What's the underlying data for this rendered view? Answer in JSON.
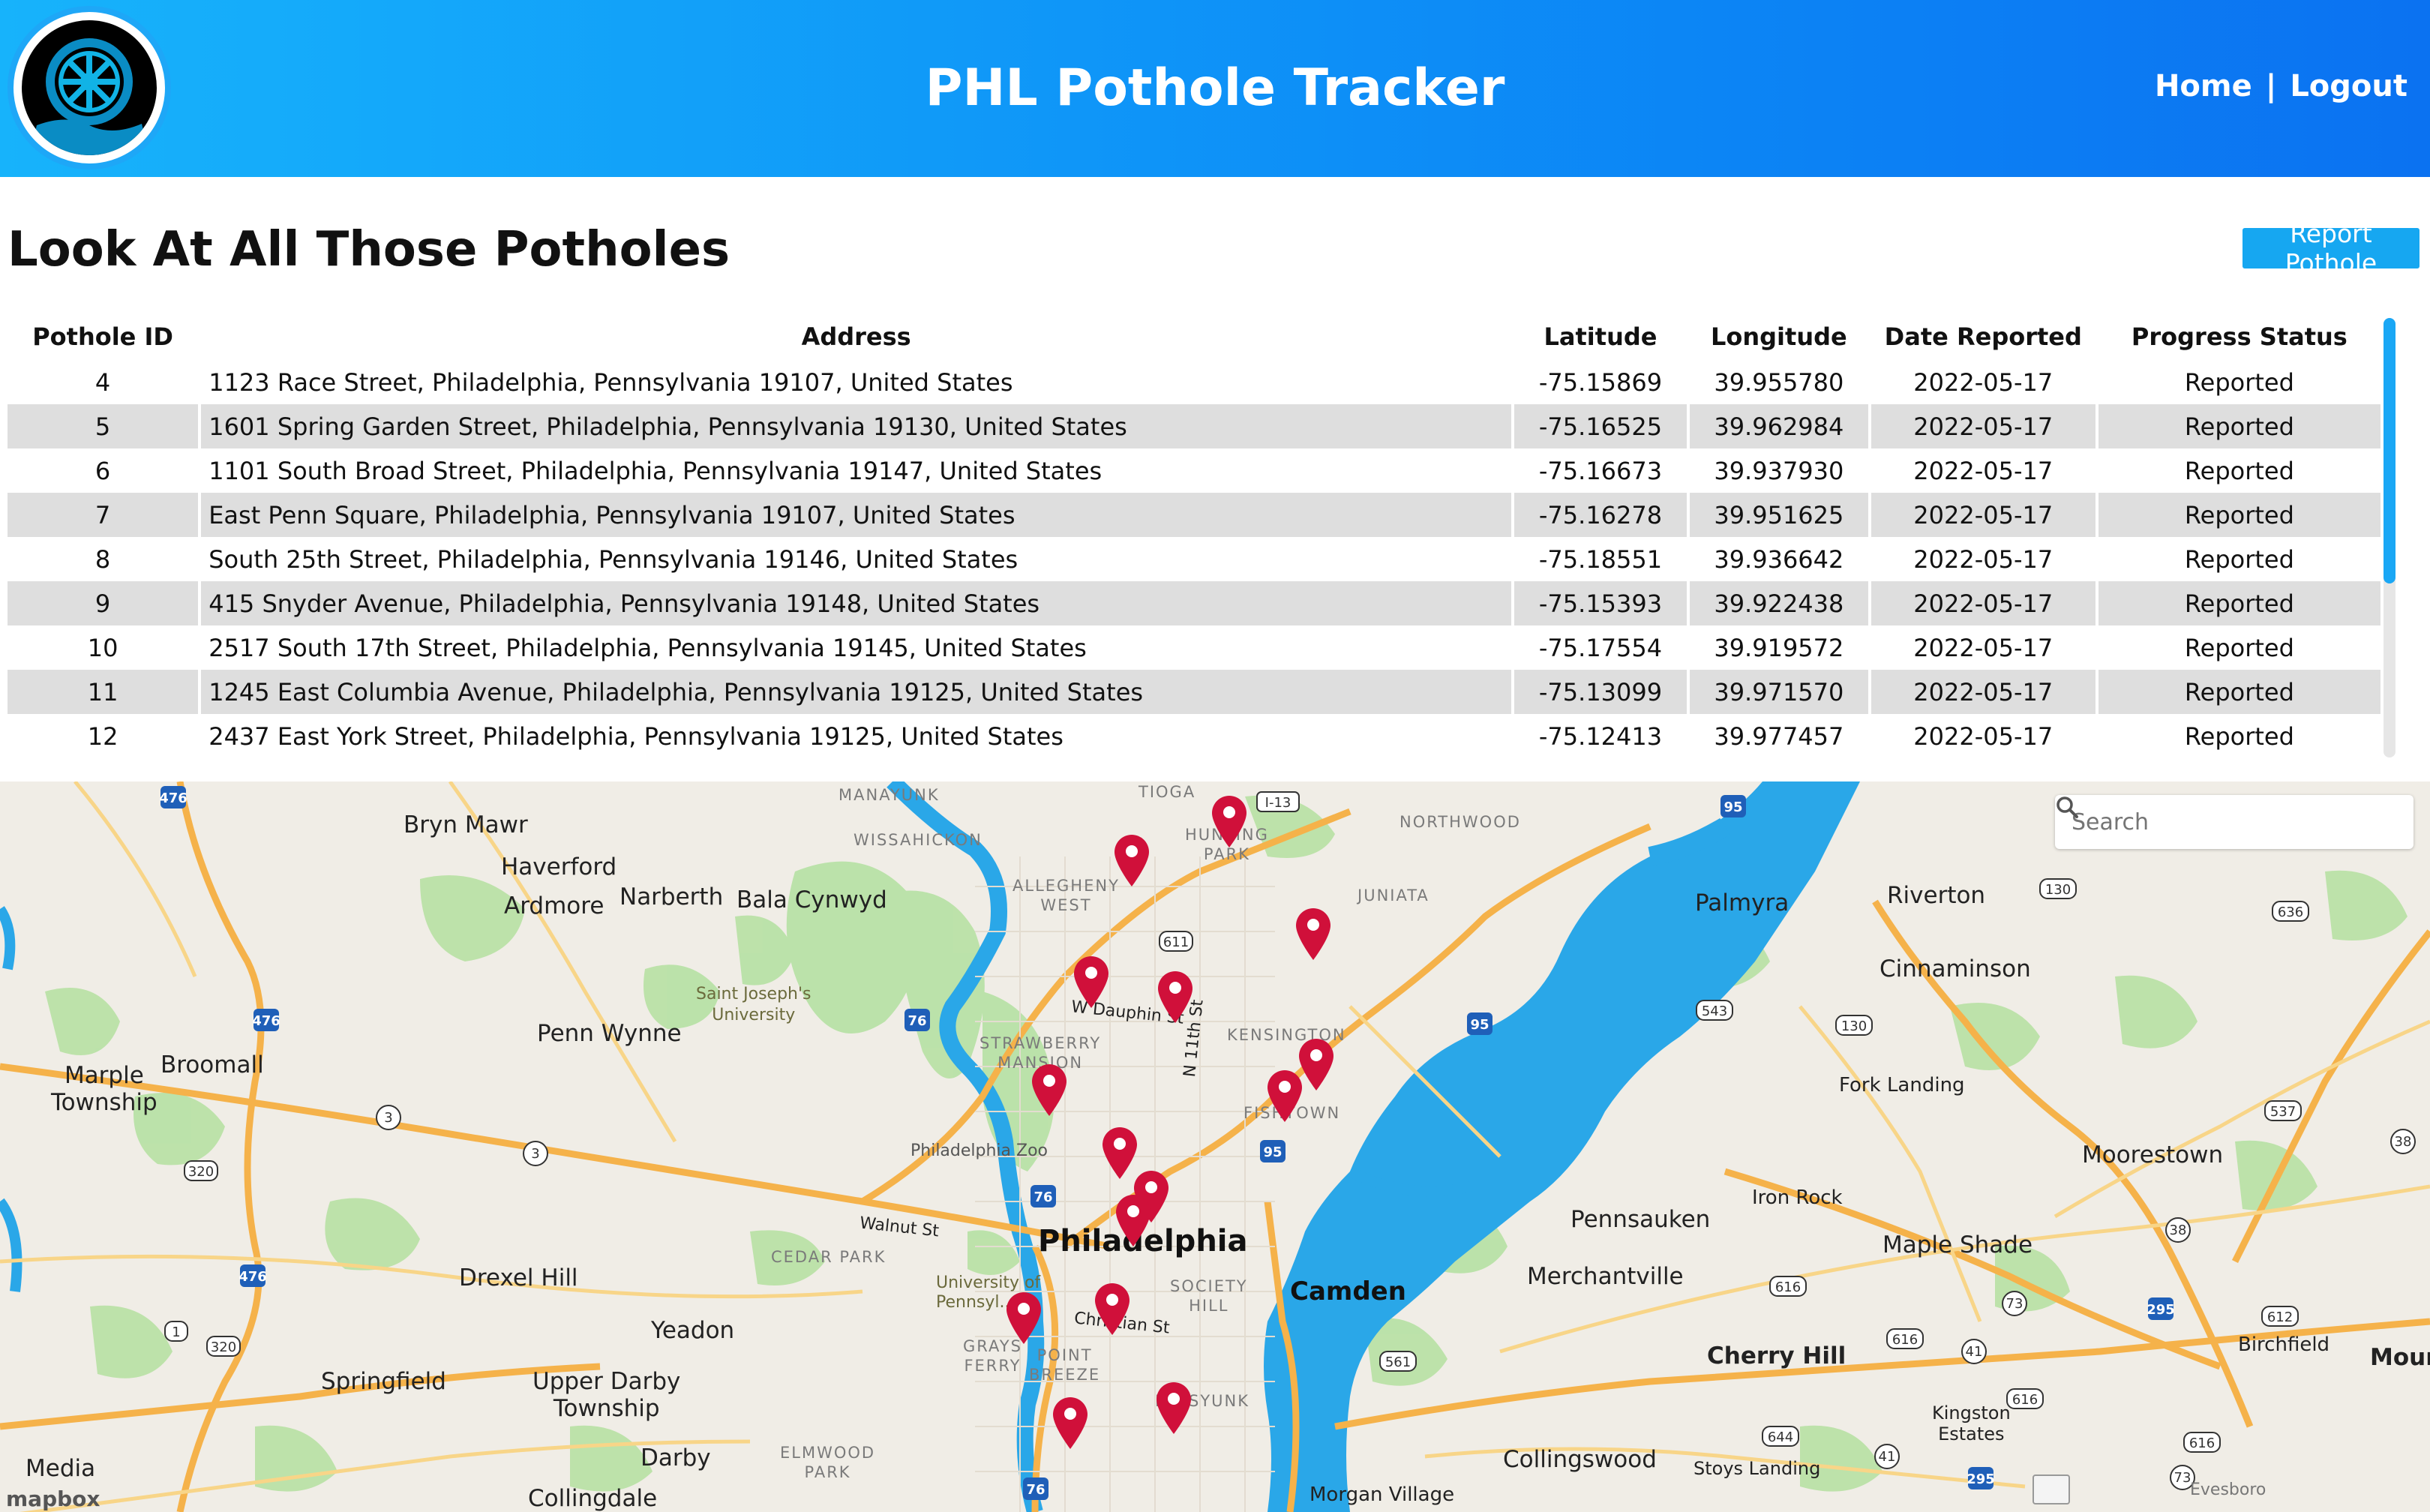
{
  "header": {
    "title": "PHL Pothole Tracker",
    "nav": {
      "home": "Home",
      "separator": "|",
      "logout": "Logout"
    }
  },
  "page": {
    "heading": "Look At All Those Potholes",
    "report_button": "Report Pothole"
  },
  "table": {
    "columns": [
      "Pothole ID",
      "Address",
      "Latitude",
      "Longitude",
      "Date Reported",
      "Progress Status"
    ],
    "rows": [
      [
        "4",
        "1123 Race Street, Philadelphia, Pennsylvania 19107, United States",
        "-75.15869",
        "39.955780",
        "2022-05-17",
        "Reported"
      ],
      [
        "5",
        "1601 Spring Garden Street, Philadelphia, Pennsylvania 19130, United States",
        "-75.16525",
        "39.962984",
        "2022-05-17",
        "Reported"
      ],
      [
        "6",
        "1101 South Broad Street, Philadelphia, Pennsylvania 19147, United States",
        "-75.16673",
        "39.937930",
        "2022-05-17",
        "Reported"
      ],
      [
        "7",
        "East Penn Square, Philadelphia, Pennsylvania 19107, United States",
        "-75.16278",
        "39.951625",
        "2022-05-17",
        "Reported"
      ],
      [
        "8",
        "South 25th Street, Philadelphia, Pennsylvania 19146, United States",
        "-75.18551",
        "39.936642",
        "2022-05-17",
        "Reported"
      ],
      [
        "9",
        "415 Snyder Avenue, Philadelphia, Pennsylvania 19148, United States",
        "-75.15393",
        "39.922438",
        "2022-05-17",
        "Reported"
      ],
      [
        "10",
        "2517 South 17th Street, Philadelphia, Pennsylvania 19145, United States",
        "-75.17554",
        "39.919572",
        "2022-05-17",
        "Reported"
      ],
      [
        "11",
        "1245 East Columbia Avenue, Philadelphia, Pennsylvania 19125, United States",
        "-75.13099",
        "39.971570",
        "2022-05-17",
        "Reported"
      ],
      [
        "12",
        "2437 East York Street, Philadelphia, Pennsylvania 19125, United States",
        "-75.12413",
        "39.977457",
        "2022-05-17",
        "Reported"
      ]
    ]
  },
  "map": {
    "search_placeholder": "Search",
    "attribution": "mapbox",
    "labels": {
      "bryn_mawr": "Bryn Mawr",
      "haverford": "Haverford",
      "ardmore": "Ardmore",
      "narberth": "Narberth",
      "bala_cynwyd": "Bala Cynwyd",
      "penn_wynne": "Penn Wynne",
      "broomall": "Broomall",
      "marple": "Marple\nTownship",
      "drexel_hill": "Drexel Hill",
      "yeadon": "Yeadon",
      "springfield": "Springfield",
      "upper_darby": "Upper Darby\nTownship",
      "darby": "Darby",
      "media": "Media",
      "collingdale": "Collingdale",
      "philadelphia": "Philadelphia",
      "camden": "Camden",
      "pennsauken": "Pennsauken",
      "merchantville": "Merchantville",
      "cherry_hill": "Cherry Hill",
      "maple_shade": "Maple Shade",
      "moorestown": "Moorestown",
      "palmyra": "Palmyra",
      "riverton": "Riverton",
      "cinnaminson": "Cinnaminson",
      "fork_landing": "Fork Landing",
      "iron_rock": "Iron Rock",
      "collingswood": "Collingswood",
      "birchfield": "Birchfield",
      "kingston_estates": "Kingston\nEstates",
      "stoys_landing": "Stoys Landing",
      "morgan_village": "Morgan Village",
      "evesboro": "Evesboro",
      "mount": "Mount",
      "saint_josephs": "Saint Joseph's\nUniversity",
      "phila_zoo": "Philadelphia Zoo",
      "univ_penn": "University of\nPennsyl...",
      "manayunk": "MANAYUNK",
      "wissahickon": "WISSAHICKON",
      "tioga": "TIOGA",
      "hunting_park": "HUNTING\nPARK",
      "northwood": "NORTHWOOD",
      "allegheny_west": "ALLEGHENY\nWEST",
      "juniata": "JUNIATA",
      "strawberry_mansion": "STRAWBERRY\nMANSION",
      "kensington": "KENSINGTON",
      "fishtown": "FISHTOWN",
      "cedar_park": "CEDAR PARK",
      "society_hill": "SOCIETY\nHILL",
      "grays_ferry": "GRAYS\nFERRY",
      "point_breeze": "POINT\nBREEZE",
      "passyunk": "PASSYUNK",
      "elmwood_park": "ELMWOOD\nPARK",
      "walnut_st": "Walnut St",
      "w_dauphin_st": "W Dauphin St",
      "n_11th_st": "N 11th St",
      "christian_st": "Christian St"
    }
  },
  "colors": {
    "header_start": "#17b3fb",
    "header_end": "#0b72f1",
    "accent": "#16a7f1",
    "pin": "#d0103a",
    "water": "#2aa7e8",
    "park": "#b9e2a7"
  }
}
